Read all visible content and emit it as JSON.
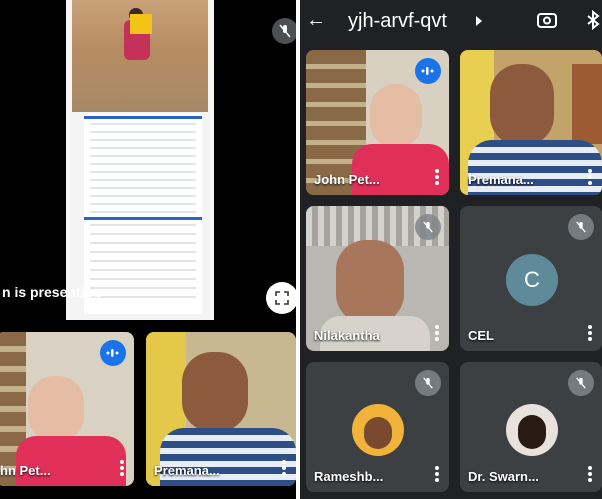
{
  "meeting": {
    "code": "yjh-arvf-qvt"
  },
  "presentation": {
    "status_text": "n is presenting"
  },
  "participants": [
    {
      "name": "John Pet...",
      "speaking": true
    },
    {
      "name": "Premana...",
      "speaking": false
    },
    {
      "name": "Nilakantha",
      "muted": true
    },
    {
      "name": "CEL",
      "initial": "C",
      "muted": true
    },
    {
      "name": "Rameshb...",
      "muted": true
    },
    {
      "name": "Dr. Swarn...",
      "muted": true
    }
  ],
  "left_strip": [
    {
      "name": "hn Pet...",
      "speaking": true
    },
    {
      "name": "Premana..."
    }
  ],
  "icons": {
    "back": "arrow-left-icon",
    "dropdown": "chevron-right-icon",
    "switch_camera": "switch-camera-icon",
    "bluetooth": "bluetooth-icon",
    "mute": "mic-off-icon",
    "speaking": "audio-wave-icon",
    "fullscreen": "fullscreen-icon",
    "more": "more-vert-icon"
  },
  "colors": {
    "accent": "#1a73e8",
    "cel_avatar": "#5f8a99",
    "tile": "#3c4043"
  }
}
